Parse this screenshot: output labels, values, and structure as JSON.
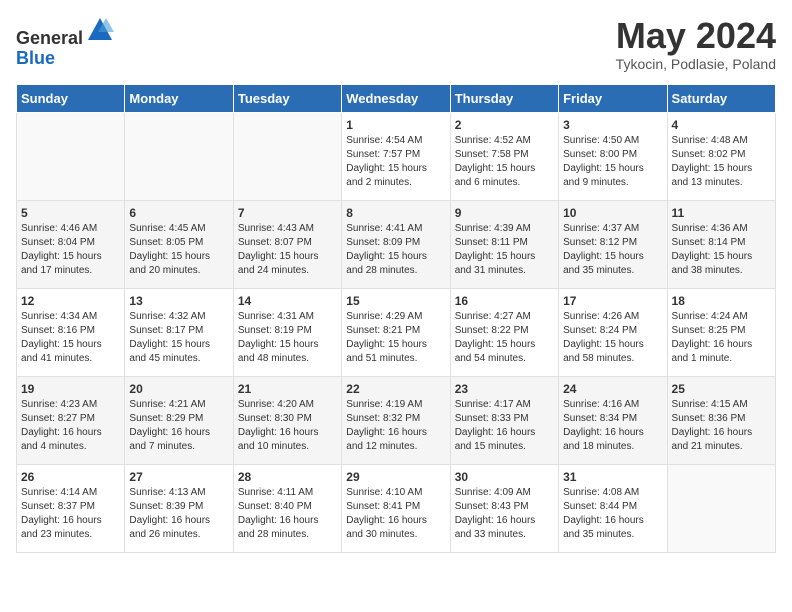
{
  "header": {
    "logo_line1": "General",
    "logo_line2": "Blue",
    "month": "May 2024",
    "location": "Tykocin, Podlasie, Poland"
  },
  "weekdays": [
    "Sunday",
    "Monday",
    "Tuesday",
    "Wednesday",
    "Thursday",
    "Friday",
    "Saturday"
  ],
  "weeks": [
    [
      {
        "day": "",
        "info": ""
      },
      {
        "day": "",
        "info": ""
      },
      {
        "day": "",
        "info": ""
      },
      {
        "day": "1",
        "info": "Sunrise: 4:54 AM\nSunset: 7:57 PM\nDaylight: 15 hours\nand 2 minutes."
      },
      {
        "day": "2",
        "info": "Sunrise: 4:52 AM\nSunset: 7:58 PM\nDaylight: 15 hours\nand 6 minutes."
      },
      {
        "day": "3",
        "info": "Sunrise: 4:50 AM\nSunset: 8:00 PM\nDaylight: 15 hours\nand 9 minutes."
      },
      {
        "day": "4",
        "info": "Sunrise: 4:48 AM\nSunset: 8:02 PM\nDaylight: 15 hours\nand 13 minutes."
      }
    ],
    [
      {
        "day": "5",
        "info": "Sunrise: 4:46 AM\nSunset: 8:04 PM\nDaylight: 15 hours\nand 17 minutes."
      },
      {
        "day": "6",
        "info": "Sunrise: 4:45 AM\nSunset: 8:05 PM\nDaylight: 15 hours\nand 20 minutes."
      },
      {
        "day": "7",
        "info": "Sunrise: 4:43 AM\nSunset: 8:07 PM\nDaylight: 15 hours\nand 24 minutes."
      },
      {
        "day": "8",
        "info": "Sunrise: 4:41 AM\nSunset: 8:09 PM\nDaylight: 15 hours\nand 28 minutes."
      },
      {
        "day": "9",
        "info": "Sunrise: 4:39 AM\nSunset: 8:11 PM\nDaylight: 15 hours\nand 31 minutes."
      },
      {
        "day": "10",
        "info": "Sunrise: 4:37 AM\nSunset: 8:12 PM\nDaylight: 15 hours\nand 35 minutes."
      },
      {
        "day": "11",
        "info": "Sunrise: 4:36 AM\nSunset: 8:14 PM\nDaylight: 15 hours\nand 38 minutes."
      }
    ],
    [
      {
        "day": "12",
        "info": "Sunrise: 4:34 AM\nSunset: 8:16 PM\nDaylight: 15 hours\nand 41 minutes."
      },
      {
        "day": "13",
        "info": "Sunrise: 4:32 AM\nSunset: 8:17 PM\nDaylight: 15 hours\nand 45 minutes."
      },
      {
        "day": "14",
        "info": "Sunrise: 4:31 AM\nSunset: 8:19 PM\nDaylight: 15 hours\nand 48 minutes."
      },
      {
        "day": "15",
        "info": "Sunrise: 4:29 AM\nSunset: 8:21 PM\nDaylight: 15 hours\nand 51 minutes."
      },
      {
        "day": "16",
        "info": "Sunrise: 4:27 AM\nSunset: 8:22 PM\nDaylight: 15 hours\nand 54 minutes."
      },
      {
        "day": "17",
        "info": "Sunrise: 4:26 AM\nSunset: 8:24 PM\nDaylight: 15 hours\nand 58 minutes."
      },
      {
        "day": "18",
        "info": "Sunrise: 4:24 AM\nSunset: 8:25 PM\nDaylight: 16 hours\nand 1 minute."
      }
    ],
    [
      {
        "day": "19",
        "info": "Sunrise: 4:23 AM\nSunset: 8:27 PM\nDaylight: 16 hours\nand 4 minutes."
      },
      {
        "day": "20",
        "info": "Sunrise: 4:21 AM\nSunset: 8:29 PM\nDaylight: 16 hours\nand 7 minutes."
      },
      {
        "day": "21",
        "info": "Sunrise: 4:20 AM\nSunset: 8:30 PM\nDaylight: 16 hours\nand 10 minutes."
      },
      {
        "day": "22",
        "info": "Sunrise: 4:19 AM\nSunset: 8:32 PM\nDaylight: 16 hours\nand 12 minutes."
      },
      {
        "day": "23",
        "info": "Sunrise: 4:17 AM\nSunset: 8:33 PM\nDaylight: 16 hours\nand 15 minutes."
      },
      {
        "day": "24",
        "info": "Sunrise: 4:16 AM\nSunset: 8:34 PM\nDaylight: 16 hours\nand 18 minutes."
      },
      {
        "day": "25",
        "info": "Sunrise: 4:15 AM\nSunset: 8:36 PM\nDaylight: 16 hours\nand 21 minutes."
      }
    ],
    [
      {
        "day": "26",
        "info": "Sunrise: 4:14 AM\nSunset: 8:37 PM\nDaylight: 16 hours\nand 23 minutes."
      },
      {
        "day": "27",
        "info": "Sunrise: 4:13 AM\nSunset: 8:39 PM\nDaylight: 16 hours\nand 26 minutes."
      },
      {
        "day": "28",
        "info": "Sunrise: 4:11 AM\nSunset: 8:40 PM\nDaylight: 16 hours\nand 28 minutes."
      },
      {
        "day": "29",
        "info": "Sunrise: 4:10 AM\nSunset: 8:41 PM\nDaylight: 16 hours\nand 30 minutes."
      },
      {
        "day": "30",
        "info": "Sunrise: 4:09 AM\nSunset: 8:43 PM\nDaylight: 16 hours\nand 33 minutes."
      },
      {
        "day": "31",
        "info": "Sunrise: 4:08 AM\nSunset: 8:44 PM\nDaylight: 16 hours\nand 35 minutes."
      },
      {
        "day": "",
        "info": ""
      }
    ]
  ]
}
